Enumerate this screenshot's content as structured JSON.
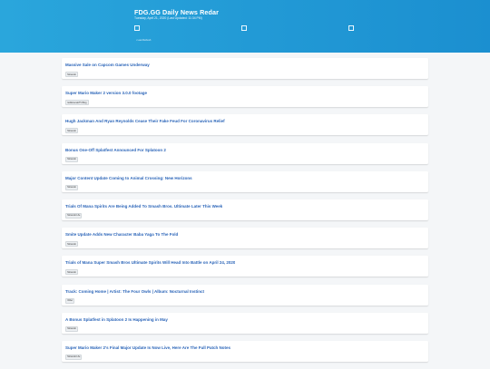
{
  "header": {
    "title": "FDG.GG Daily News Redar",
    "subtitle": "Tuesday, April 21, 2020 (Last Updated: 11:34 PM)",
    "note": "• Last Refresh"
  },
  "feed": [
    {
      "title": "Massive Sale on Capcom Games Underway",
      "tag": "Nintendo"
    },
    {
      "title": "Super Mario Maker 2 version 3.0.0 footage",
      "tag": "GoNintendoTV Blog"
    },
    {
      "title": "Hugh Jackman And Ryan Reynolds Cease Their Fake Feud For Coronavirus Relief",
      "tag": "Nintendo"
    },
    {
      "title": "Bonus One-Off Splatfest Announced For Splatoon 2",
      "tag": "Nintendo"
    },
    {
      "title": "Major Content Update Coming to Animal Crossing: New Horizons",
      "tag": "Nintendo"
    },
    {
      "title": "Trials Of Mana Spirits Are Being Added To Smash Bros. Ultimate Later This Week",
      "tag": "Nintendo Life"
    },
    {
      "title": "Smite Update Adds New Character Baba Yaga To The Fold",
      "tag": "Nintendo"
    },
    {
      "title": "Trials of Mana Super Smash Bros Ultimate Spirits Will Head Into Battle on April 24, 2020",
      "tag": "Nintendo"
    },
    {
      "title": "Track: Coming Home | Artist: The Four Owls | Album: Nocturnal Instinct",
      "tag": "Other"
    },
    {
      "title": "A Bonus Splatfest in Splatoon 2 Is Happening in May",
      "tag": "Nintendo"
    },
    {
      "title": "Super Mario Maker 2's Final Major Update Is Now Live, Here Are The Full Patch Notes",
      "tag": "Nintendo Life"
    }
  ]
}
